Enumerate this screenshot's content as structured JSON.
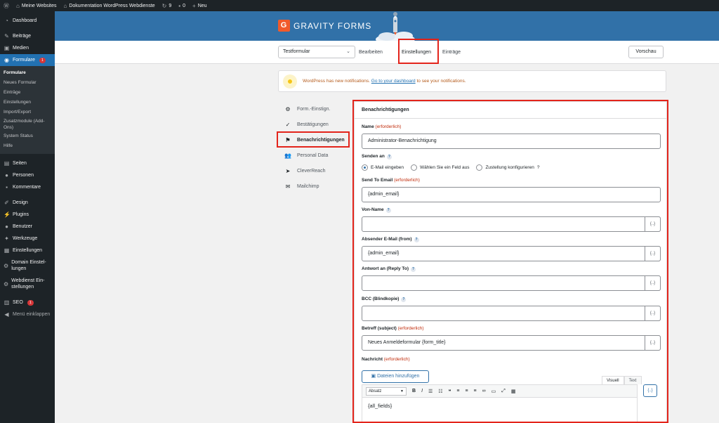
{
  "adminbar": {
    "site_name": "Meine Websites",
    "site_title": "Dokumentation WordPress Webdienste",
    "updates_count": "9",
    "comments_count": "0",
    "new_label": "Neu"
  },
  "sidebar": {
    "dashboard": "Dashboard",
    "beitraege": "Beiträge",
    "medien": "Medien",
    "formulare": "Formulare",
    "formulare_badge": "1",
    "sub": [
      "Formulare",
      "Neues Formular",
      "Einträge",
      "Einstellungen",
      "Import/Export",
      "Zusatzmodule (Add-Ons)",
      "System Status",
      "Hilfe"
    ],
    "seiten": "Seiten",
    "personen": "Personen",
    "kommentare": "Kommentare",
    "design": "Design",
    "plugins": "Plugins",
    "benutzer": "Benutzer",
    "werkzeuge": "Werkzeuge",
    "einstellungen": "Einstellungen",
    "domain": "Domain Einstel-lungen",
    "webdienst": "Webdienst Ein-stellungen",
    "seo": "SEO",
    "seo_badge": "1",
    "collapse": "Menü einklappen"
  },
  "header": {
    "logo_text": "GRAVITY FORMS",
    "logo_letter": "G"
  },
  "toolbar": {
    "form_name": "Testformular",
    "tab_edit": "Bearbeiten",
    "tab_settings": "Einstellungen",
    "tab_entries": "Einträge",
    "preview": "Vorschau"
  },
  "notice": {
    "text_before": "WordPress has new notifications.",
    "link": "Go to your dashboard",
    "text_after": "to see your notifications."
  },
  "settings_nav": [
    "Form.-Einstign.",
    "Bestätigungen",
    "Benachrichtigungen",
    "Personal Data",
    "CleverReach",
    "Mailchimp"
  ],
  "panel": {
    "title": "Benachrichtigungen",
    "required": "(erforderlich)",
    "name_label": "Name",
    "name_value": "Administrator-Benachrichtigung",
    "send_to_label": "Senden an",
    "radio_email": "E-Mail eingeben",
    "radio_field": "Wählen Sie ein Feld aus",
    "radio_routing": "Zustellung konfigurieren",
    "send_to_email_label": "Send To Email",
    "send_to_email_value": "{admin_email}",
    "from_name_label": "Von-Name",
    "from_name_value": "",
    "from_email_label": "Absender E-Mail (from)",
    "from_email_value": "{admin_email}",
    "reply_to_label": "Antwort an (Reply To)",
    "reply_to_value": "",
    "bcc_label": "BCC (Blindkopie)",
    "bcc_value": "",
    "subject_label": "Betreff (subject)",
    "subject_value": "Neues Anmeldeformular {form_title}",
    "message_label": "Nachricht",
    "add_media": "Dateien hinzufügen",
    "tab_visual": "Visuell",
    "tab_text": "Text",
    "format_select": "Absatz",
    "message_value": "{all_fields}",
    "merge_tag": "{..}"
  }
}
